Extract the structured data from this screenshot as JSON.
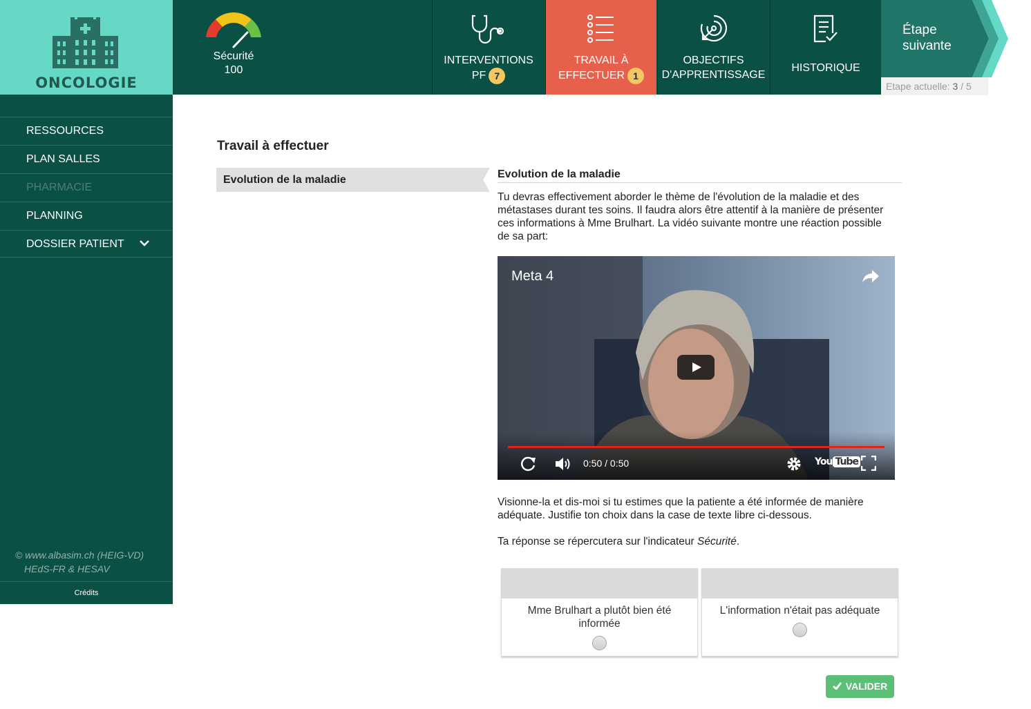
{
  "logo": {
    "title": "ONCOLOGIE"
  },
  "gauge": {
    "label": "Sécurité",
    "value": "100"
  },
  "nav": [
    {
      "label_line1": "INTERVENTIONS",
      "label_line2": "PF",
      "badge": "7",
      "icon": "stethoscope-icon"
    },
    {
      "label_line1": "TRAVAIL À",
      "label_line2": "EFFECTUER",
      "badge": "1",
      "icon": "list-icon",
      "active": true
    },
    {
      "label_line1": "OBJECTIFS",
      "label_line2": "D'APPRENTISSAGE",
      "icon": "target-icon"
    },
    {
      "label_line1": "HISTORIQUE",
      "icon": "clipboard-icon"
    }
  ],
  "next_step": {
    "line1": "Étape",
    "line2": "suivante"
  },
  "etape": {
    "label": "Etape actuelle:",
    "current": "3",
    "sep": "/",
    "total": "5"
  },
  "sidebar": {
    "items": [
      {
        "label": "RESSOURCES",
        "disabled": false
      },
      {
        "label": "PLAN SALLES",
        "disabled": false
      },
      {
        "label": "PHARMACIE",
        "disabled": true
      },
      {
        "label": "PLANNING",
        "disabled": false
      },
      {
        "label": "DOSSIER PATIENT",
        "disabled": false,
        "expandable": true
      }
    ],
    "copyright_line1": "© www.albasim.ch (HEIG-VD)",
    "copyright_line2": "HEdS-FR & HESAV",
    "credits": "Crédits"
  },
  "main": {
    "title": "Travail à effectuer",
    "task_item": "Evolution de la maladie",
    "section_title": "Evolution de la maladie",
    "intro": "Tu devras effectivement aborder le thème de l'évolution de la maladie et des métastases durant tes soins. Il faudra alors être attentif à la manière de présenter ces informations à Mme Brulhart. La vidéo suivante montre une réaction possible de sa part:",
    "video": {
      "title": "Meta 4",
      "time": "0:50 / 0:50",
      "progress": 1.0,
      "brand_you": "You",
      "brand_tube": "Tube"
    },
    "instruction": "Visionne-la et dis-moi si tu estimes que la patiente a été informée de manière adéquate. Justifie ton choix dans la case de texte libre ci-dessous.",
    "impact_prefix": "Ta réponse se répercutera sur l'indicateur ",
    "impact_indicator": "Sécurité",
    "impact_suffix": ".",
    "choices": [
      {
        "label": "Mme Brulhart a plutôt bien été informée"
      },
      {
        "label": "L'information n'était pas adéquate"
      }
    ],
    "validate_label": "VALIDER"
  },
  "colors": {
    "primary": "#0b5045",
    "active_tab": "#e7604c",
    "logo_bg": "#66d8c6",
    "badge": "#f3c761",
    "validate": "#5cbf76"
  }
}
